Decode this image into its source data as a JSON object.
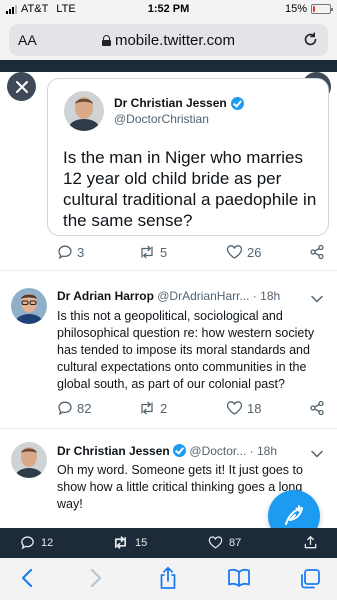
{
  "status_bar": {
    "carrier": "AT&T",
    "network": "LTE",
    "time": "1:52 PM",
    "battery": "15%",
    "battery_level": 0.15
  },
  "browser": {
    "aa_label": "AA",
    "url": "mobile.twitter.com",
    "icons": [
      "lock-icon",
      "reload-icon"
    ]
  },
  "quoted_tweet": {
    "author_name": "Dr Christian Jessen",
    "author_handle": "@DoctorChristian",
    "verified": true,
    "text": "Is the man in Niger who marries 12 year old child bride as per cultural traditional a paedophile in the same sense?",
    "replies": "3",
    "retweets": "5",
    "likes": "26"
  },
  "replies": [
    {
      "author_name": "Dr Adrian Harrop",
      "author_handle": "@DrAdrianHarr...",
      "separator": "·",
      "time": "18h",
      "verified": false,
      "text": "Is this not a geopolitical, sociological and philosophical question re: how western society has tended to impose its moral standards and cultural expectations onto communities in the global south, as part of our colonial past?",
      "replies": "82",
      "retweets": "2",
      "likes": "18"
    },
    {
      "author_name": "Dr Christian Jessen",
      "author_handle": "@Doctor...",
      "separator": "·",
      "time": "18h",
      "verified": true,
      "text": "Oh my word. Someone gets it! It just goes to show how a little critical thinking goes a long way!"
    }
  ],
  "tweet_stats": {
    "replies": "12",
    "retweets": "15",
    "likes": "87"
  },
  "colors": {
    "accent": "#1d9bf0",
    "dark_bar": "#1c2a3a",
    "muted_text": "#536471"
  }
}
